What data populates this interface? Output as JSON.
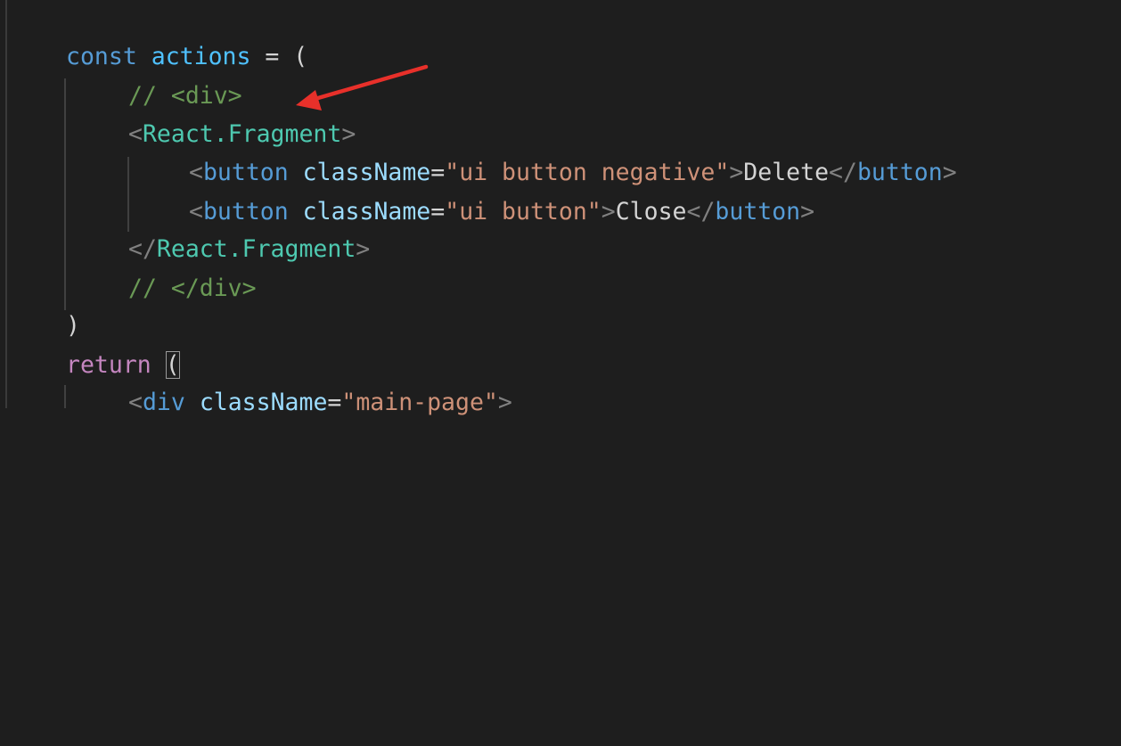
{
  "code": {
    "line1": {
      "keyword": "const",
      "name": "actions",
      "rest": " = ("
    },
    "line2": {
      "comment": "// <div>"
    },
    "line3": {
      "open": "<",
      "component": "React.Fragment",
      "close": ">"
    },
    "line4": {
      "open": "<",
      "tag": "button",
      "attr": "className",
      "eq": "=",
      "value": "\"ui button negative\"",
      "gt": ">",
      "text": "Delete",
      "close_open": "</",
      "close_tag": "button",
      "close_gt": ">"
    },
    "line5": {
      "open": "<",
      "tag": "button",
      "attr": "className",
      "eq": "=",
      "value": "\"ui button\"",
      "gt": ">",
      "text": "Close",
      "close_open": "</",
      "close_tag": "button",
      "close_gt": ">"
    },
    "line6": {
      "open": "</",
      "component": "React.Fragment",
      "close": ">"
    },
    "line7": {
      "comment": "// </div>"
    },
    "line8": {
      "text": ")"
    },
    "line9": {
      "keyword": "return",
      "paren": "("
    },
    "line10": {
      "open": "<",
      "tag": "div",
      "attr": "className",
      "eq": "=",
      "value": "\"main-page\"",
      "gt": ">"
    }
  },
  "colors": {
    "background": "#1e1e1e",
    "annotation_arrow": "#e8302a"
  }
}
